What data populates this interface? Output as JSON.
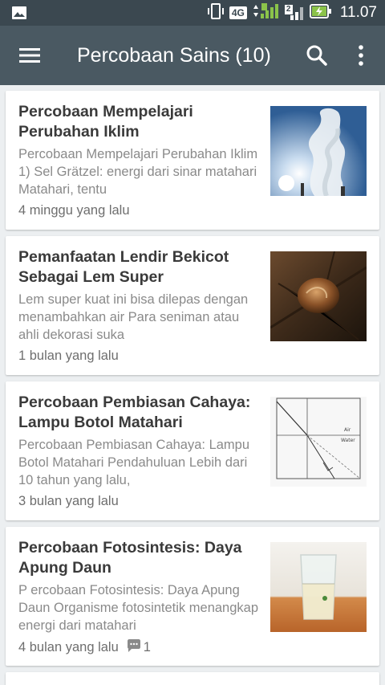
{
  "statusbar": {
    "network": "4G",
    "sim": "2",
    "time": "11.07"
  },
  "appbar": {
    "title": "Percobaan Sains (10)"
  },
  "posts": [
    {
      "title": "Percobaan Mempelajari Perubahan Iklim",
      "snippet": "Percobaan Mempelajari Perubahan Iklim 1) Sel Grätzel: energi dari sinar matahari Matahari, tentu",
      "time": "4 minggu yang lalu"
    },
    {
      "title": "Pemanfaatan Lendir Bekicot Sebagai Lem Super",
      "snippet": "Lem super kuat ini bisa dilepas dengan menambahkan air Para seniman atau ahli dekorasi suka",
      "time": "1 bulan yang lalu"
    },
    {
      "title": "Percobaan Pembiasan Cahaya: Lampu Botol Matahari",
      "snippet": "Percobaan Pembiasan Cahaya: Lampu Botol Matahari Pendahuluan Lebih dari 10 tahun yang lalu,",
      "time": "3 bulan yang lalu",
      "thumb_labels": [
        "Air",
        "Water"
      ]
    },
    {
      "title": "Percobaan Fotosintesis: Daya Apung Daun",
      "snippet": "P ercobaan Fotosintesis: Daya Apung Daun Organisme fotosintetik menangkap energi dari matahari",
      "time": "4 bulan yang lalu",
      "comments": "1"
    }
  ],
  "colors": {
    "statusbar": "#3b4850",
    "appbar": "#4a5962",
    "background": "#eceff1",
    "title_text": "#3a3a3a",
    "snippet_text": "#8a8a8a"
  },
  "icons": [
    "image-icon",
    "vibrate-icon",
    "signal-icon",
    "battery-charging-icon",
    "menu-icon",
    "search-icon",
    "more-vert-icon",
    "comment-icon"
  ]
}
